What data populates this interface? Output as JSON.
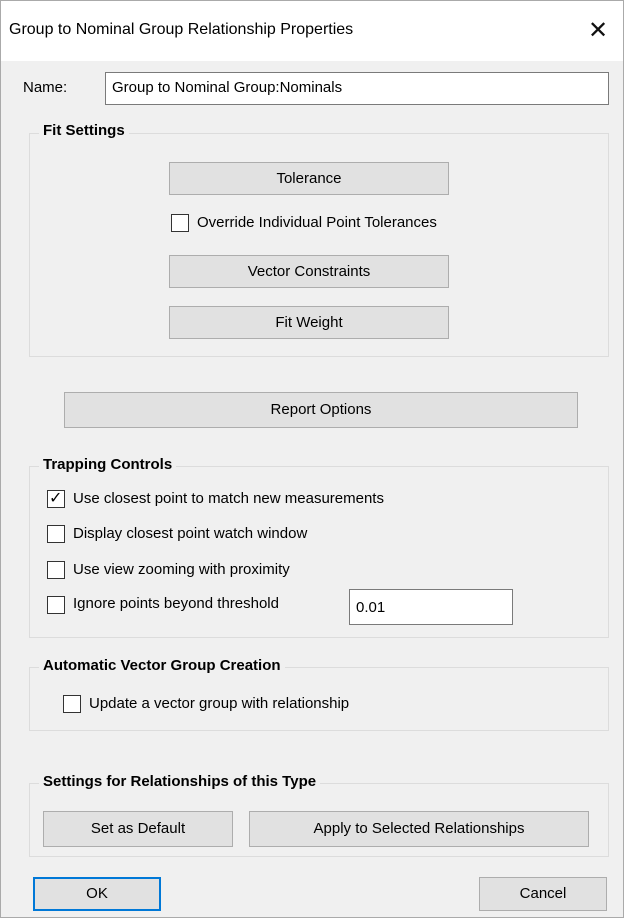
{
  "dialog": {
    "title": "Group to Nominal Group Relationship Properties",
    "close_symbol": "✕",
    "name_label": "Name:",
    "name_value": "Group to Nominal Group:Nominals"
  },
  "fit_settings": {
    "heading": "Fit Settings",
    "tolerance_label": "Tolerance",
    "override_label": "Override Individual Point Tolerances",
    "override_checked": false,
    "vector_constraints_label": "Vector Constraints",
    "fit_weight_label": "Fit Weight"
  },
  "report_options_label": "Report Options",
  "trapping": {
    "heading": "Trapping Controls",
    "options": [
      {
        "label": "Use closest point to match new measurements",
        "checked": true
      },
      {
        "label": "Display closest point watch window",
        "checked": false
      },
      {
        "label": "Use view zooming with proximity",
        "checked": false
      },
      {
        "label": "Ignore points beyond threshold",
        "checked": false
      }
    ],
    "threshold_value": "0.01"
  },
  "auto_vector": {
    "heading": "Automatic Vector Group Creation",
    "update_label": "Update a vector group with relationship",
    "update_checked": false
  },
  "settings_type": {
    "heading": "Settings for Relationships of this Type",
    "set_default_label": "Set as Default",
    "apply_selected_label": "Apply to Selected Relationships"
  },
  "footer": {
    "ok_label": "OK",
    "cancel_label": "Cancel"
  },
  "checkmark_glyph": "✓"
}
